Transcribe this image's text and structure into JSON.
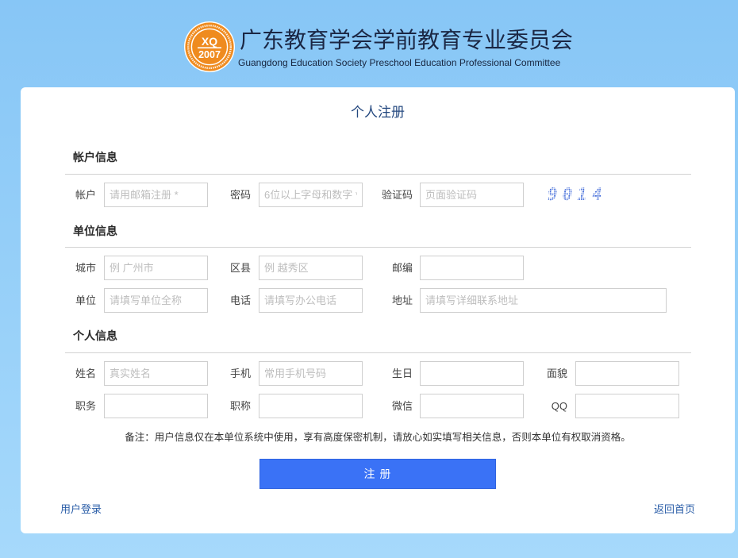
{
  "header": {
    "logo": {
      "line1": "XQ",
      "line2": "2007"
    },
    "title": "广东教育学会学前教育专业委员会",
    "subtitle": "Guangdong Education Society Preschool Education Professional Committee"
  },
  "form": {
    "title": "个人注册",
    "account": {
      "heading": "帐户信息",
      "fields": [
        {
          "label": "帐户",
          "placeholder": "请用邮箱注册 *",
          "value": ""
        },
        {
          "label": "密码",
          "placeholder": "6位以上字母和数字 *",
          "value": ""
        },
        {
          "label": "验证码",
          "placeholder": "页面验证码",
          "value": ""
        }
      ],
      "captcha": "9014"
    },
    "organization": {
      "heading": "单位信息",
      "fields": [
        {
          "label": "城市",
          "placeholder": "例 广州市",
          "value": ""
        },
        {
          "label": "区县",
          "placeholder": "例 越秀区",
          "value": ""
        },
        {
          "label": "邮编",
          "value": ""
        },
        {
          "label": "单位",
          "placeholder": "请填写单位全称",
          "value": ""
        },
        {
          "label": "电话",
          "placeholder": "请填写办公电话",
          "value": ""
        },
        {
          "label": "地址",
          "placeholder": "请填写详细联系地址",
          "value": ""
        }
      ]
    },
    "personal": {
      "heading": "个人信息",
      "fields": [
        {
          "label": "姓名",
          "placeholder": "真实姓名",
          "value": ""
        },
        {
          "label": "手机",
          "placeholder": "常用手机号码",
          "value": ""
        },
        {
          "label": "生日",
          "value": ""
        },
        {
          "label": "面貌",
          "value": ""
        },
        {
          "label": "职务",
          "value": ""
        },
        {
          "label": "职称",
          "value": ""
        },
        {
          "label": "微信",
          "value": ""
        },
        {
          "label": "QQ",
          "value": ""
        }
      ]
    },
    "note": "备注：用户信息仅在本单位系统中使用，享有高度保密机制，请放心如实填写相关信息，否则本单位有权取消资格。",
    "submit_label": "注 册"
  },
  "links": {
    "login": "用户登录",
    "home": "返回首页"
  },
  "colors": {
    "accent": "#3a72f6",
    "link": "#2b5ea8",
    "logo": "#ef8b1f",
    "title": "#24487f",
    "bg-top": "#87c6f6",
    "bg-bottom": "#a6d9fb"
  }
}
